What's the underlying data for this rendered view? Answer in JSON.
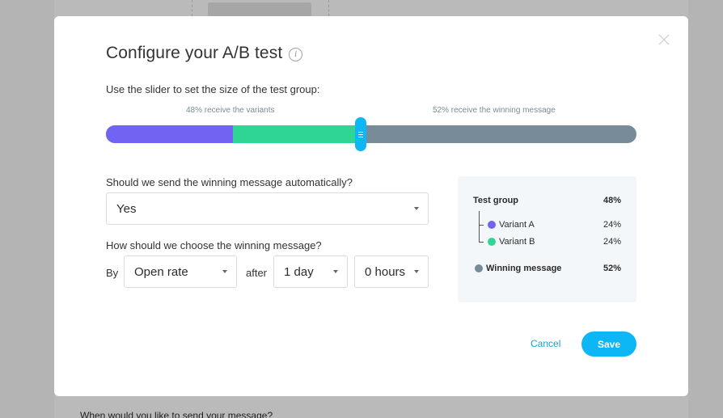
{
  "background": {
    "question": "When would you like to send your message?"
  },
  "modal": {
    "title": "Configure your A/B test",
    "info_icon": "info-icon",
    "slider": {
      "instruction": "Use the slider to set the size of the test group:",
      "caption_left": "48% receive the variants",
      "caption_right": "52% receive the winning message",
      "test_group_fraction": 0.48,
      "variant_a_fraction": 0.24,
      "variant_b_fraction": 0.24,
      "winning_fraction": 0.52,
      "colors": {
        "variant_a": "#7264f2",
        "variant_b": "#2fd594",
        "winning": "#778b98",
        "thumb": "#0db7f5"
      }
    },
    "auto_send": {
      "question": "Should we send the winning message automatically?",
      "value": "Yes"
    },
    "choose_winner": {
      "question": "How should we choose the winning message?",
      "by_label": "By",
      "metric": "Open rate",
      "after_label": "after",
      "days": "1 day",
      "hours": "0 hours"
    },
    "summary": {
      "test_group": {
        "label": "Test group",
        "pct": "48%"
      },
      "variants": [
        {
          "label": "Variant A",
          "pct": "24%",
          "color": "#7264f2"
        },
        {
          "label": "Variant B",
          "pct": "24%",
          "color": "#2fd594"
        }
      ],
      "winning": {
        "label": "Winning message",
        "pct": "52%",
        "color": "#778b98"
      }
    },
    "buttons": {
      "cancel": "Cancel",
      "save": "Save"
    }
  }
}
